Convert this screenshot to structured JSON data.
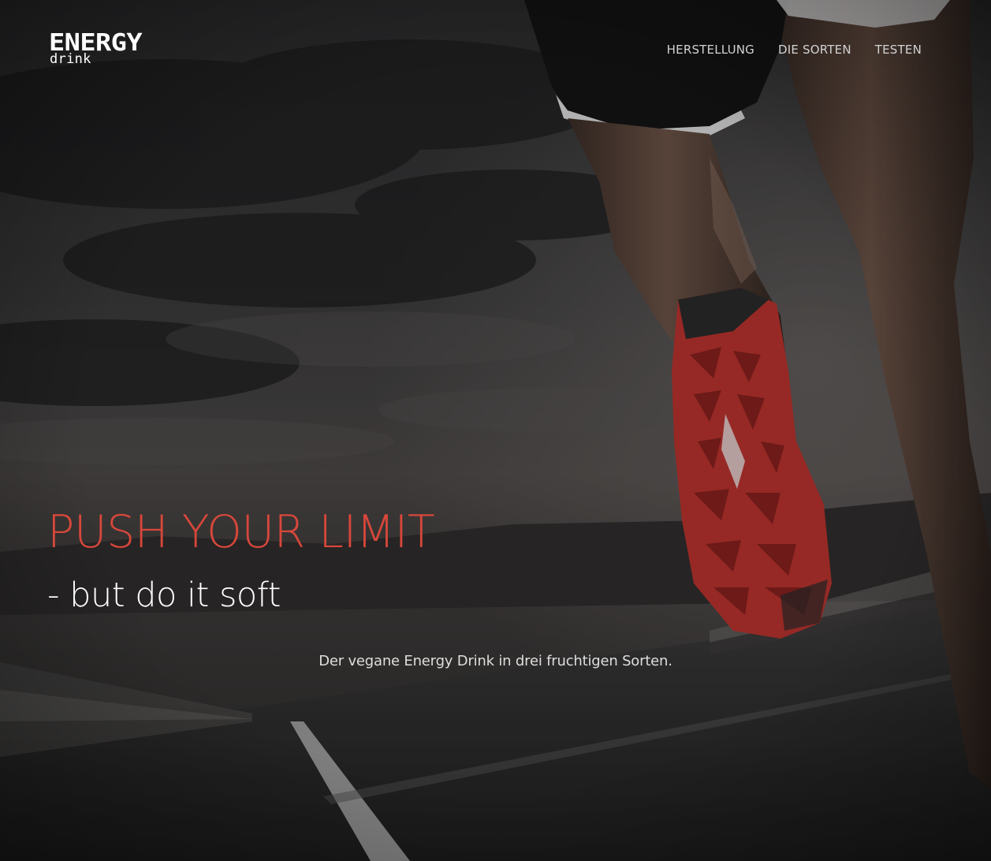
{
  "brand": {
    "line1": "ENERGY",
    "line2": "drink"
  },
  "nav": {
    "items": [
      {
        "label": "HERSTELLUNG"
      },
      {
        "label": "DIE SORTEN"
      },
      {
        "label": "TESTEN"
      }
    ]
  },
  "hero": {
    "headline": "PUSH YOUR LIMIT",
    "subheadline": "- but do it soft",
    "tagline": "Der vegane Energy Drink in drei fruchtigen Sorten."
  },
  "colors": {
    "accent": "#d8473b",
    "text": "#ffffff",
    "nav_text": "#d2d2d2"
  },
  "icons": {
    "background_image": "runner-photo"
  }
}
